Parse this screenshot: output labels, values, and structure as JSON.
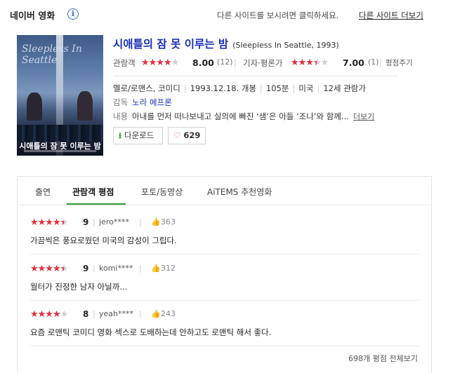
{
  "header": {
    "brand": "네이버 영화",
    "info_icon": "i",
    "notice": "다른 사이트를 보시려면 클릭하세요.",
    "more_sites_link": "다른 사이트 더보기"
  },
  "movie": {
    "poster": {
      "title_kr": "시애틀의 잠 못 이루는 밤",
      "title_en": "Sleepless In Seattle"
    },
    "title": "시애틀의 잠 못 이루는 밤",
    "original_title": "(Sleepless In Seattle, 1993)",
    "audience_rating": {
      "label": "관람객",
      "score": "8.00",
      "count": "(12)",
      "stars_fraction": 0.8
    },
    "critic_rating": {
      "label": "기자·평론가",
      "score": "7.00",
      "count": "(1)",
      "stars_fraction": 0.7,
      "link": "평점주기"
    },
    "meta": [
      "멜로/로맨스, 코미디",
      "1993.12.18. 개봉",
      "105분",
      "미국",
      "12세 관람가"
    ],
    "director_label": "감독",
    "director": "노라 에프론",
    "plot_label": "내용",
    "plot": "아내를 먼저 떠나보내고 실의에 빠진 ‘샘’은 아들 ‘조나’와 함께...",
    "plot_more": "더보기",
    "download_label": "다운로드",
    "download_icon": "download-arrow",
    "like_count": "629",
    "like_icon": "heart-outline"
  },
  "tabs": [
    {
      "label": "출연"
    },
    {
      "label": "관람객 평점"
    },
    {
      "label": "포토/동영상"
    },
    {
      "label": "AiTEMS 추천영화"
    }
  ],
  "reviews": [
    {
      "score": "9",
      "stars_fraction": 0.9,
      "user": "jero****",
      "likes": "363",
      "text": "가끔씩은 풍요로웠던 미국의 감성이 그립다."
    },
    {
      "score": "9",
      "stars_fraction": 0.9,
      "user": "komi****",
      "likes": "312",
      "text": "월터가 진정한 남자 아닐까..."
    },
    {
      "score": "8",
      "stars_fraction": 0.8,
      "user": "yeah****",
      "likes": "243",
      "text": "요즘 로맨틱 코미디 영화 섹스로 도배하는데 안하고도 로맨틱 해서 좋다."
    }
  ],
  "footer": {
    "all_reviews": "698개 평점 전체보기"
  },
  "colors": {
    "title_blue": "#1a2fb5",
    "star_red": "#e2313f",
    "tab_green": "#2d9a3a"
  }
}
